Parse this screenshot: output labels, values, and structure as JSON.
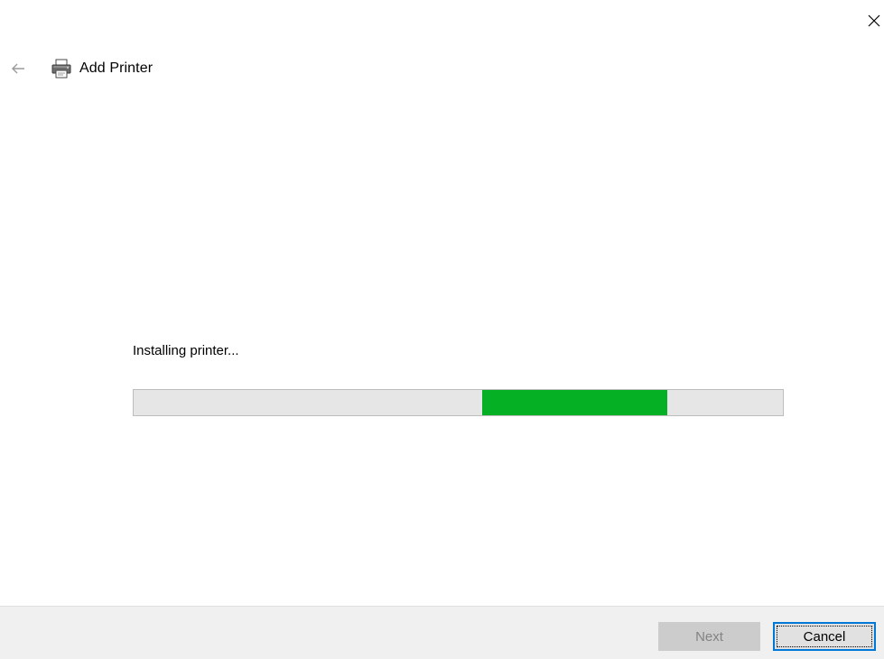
{
  "window": {
    "close_icon": "close-icon"
  },
  "header": {
    "back_icon": "arrow-left-icon",
    "printer_icon": "printer-icon",
    "title": "Add Printer"
  },
  "main": {
    "status_text": "Installing printer...",
    "progress": {
      "type": "marquee",
      "segment_start_fraction": 0.537,
      "segment_end_fraction": 0.822,
      "fill_color": "#06b025",
      "track_color": "#e6e6e6"
    }
  },
  "footer": {
    "next_label": "Next",
    "next_disabled": true,
    "cancel_label": "Cancel",
    "accent_color": "#0078d7"
  }
}
